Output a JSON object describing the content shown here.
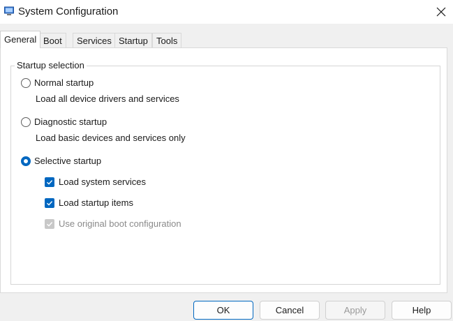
{
  "window": {
    "title": "System Configuration",
    "accent": "#0067c0"
  },
  "tabs": [
    {
      "label": "General",
      "active": true
    },
    {
      "label": "Boot"
    },
    {
      "label": "Services"
    },
    {
      "label": "Startup"
    },
    {
      "label": "Tools"
    }
  ],
  "startup_selection": {
    "group_label": "Startup selection",
    "normal": {
      "label": "Normal startup",
      "description": "Load all device drivers and services",
      "selected": false
    },
    "diagnostic": {
      "label": "Diagnostic startup",
      "description": "Load basic devices and services only",
      "selected": false
    },
    "selective": {
      "label": "Selective startup",
      "selected": true
    },
    "options": [
      {
        "label": "Load system services",
        "checked": true,
        "enabled": true
      },
      {
        "label": "Load startup items",
        "checked": true,
        "enabled": true
      },
      {
        "label": "Use original boot configuration",
        "checked": true,
        "enabled": false
      }
    ]
  },
  "buttons": {
    "ok": "OK",
    "cancel": "Cancel",
    "apply": "Apply",
    "help": "Help"
  }
}
